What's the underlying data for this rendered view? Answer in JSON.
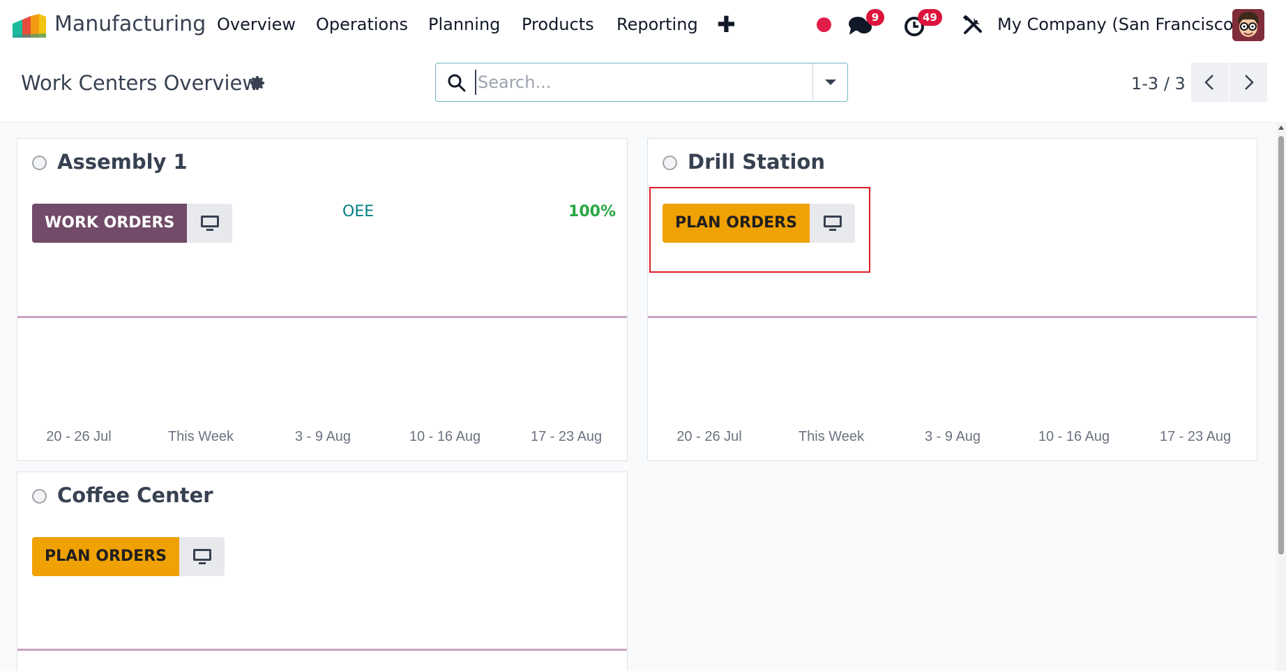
{
  "navbar": {
    "app_name": "Manufacturing",
    "menu": [
      "Overview",
      "Operations",
      "Planning",
      "Products",
      "Reporting"
    ],
    "add_icon": "plus-icon",
    "messages_badge": "9",
    "activities_badge": "49",
    "company": "My Company (San Francisco)"
  },
  "control": {
    "title": "Work Centers Overview",
    "search_placeholder": "Search...",
    "pager": "1-3 / 3"
  },
  "cards": [
    {
      "name": "Assembly 1",
      "button": "WORK ORDERS",
      "oee_label": "OEE",
      "oee_value": "100%",
      "ticks": [
        "20 - 26 Jul",
        "This Week",
        "3 - 9 Aug",
        "10 - 16 Aug",
        "17 - 23 Aug"
      ]
    },
    {
      "name": "Drill Station",
      "button": "PLAN ORDERS",
      "ticks": [
        "20 - 26 Jul",
        "This Week",
        "3 - 9 Aug",
        "10 - 16 Aug",
        "17 - 23 Aug"
      ]
    },
    {
      "name": "Coffee Center",
      "button": "PLAN ORDERS"
    }
  ],
  "colors": {
    "work_orders": "#714b67",
    "plan_orders": "#f0a103",
    "oee": "#017e84",
    "oee_value": "#28a745",
    "highlight": "#e01b24"
  }
}
